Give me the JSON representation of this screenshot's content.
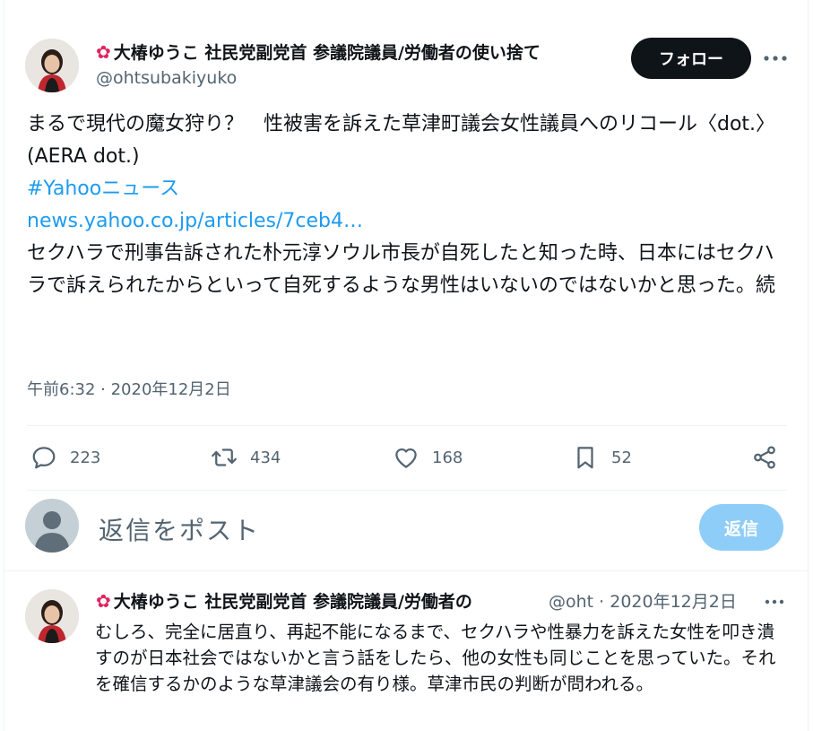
{
  "main_tweet": {
    "display_name": "大椿ゆうこ 社民党副党首 参議院議員/労働者の使い捨て",
    "handle": "@ohtsubakiyuko",
    "follow_label": "フォロー",
    "text_line1": "まるで現代の魔女狩り？　性被害を訴えた草津町議会女性議員へのリコール〈dot.〉(AERA dot.)",
    "hashtag": "#Yahooニュース",
    "link": "news.yahoo.co.jp/articles/7ceb4…",
    "text_line2": "セクハラで刑事告訴された朴元淳ソウル市長が自死したと知った時、日本にはセクハラで訴えられたからといって自死するような男性はいないのではないかと思った。続",
    "timestamp": "午前6:32 · 2020年12月2日",
    "stats": {
      "replies": "223",
      "retweets": "434",
      "likes": "168",
      "bookmarks": "52"
    }
  },
  "reply_box": {
    "placeholder": "返信をポスト",
    "button_label": "返信"
  },
  "thread_reply": {
    "display_name": "大椿ゆうこ 社民党副党首 参議院議員/労働者の",
    "meta": "@oht · 2020年12月2日",
    "text": "むしろ、完全に居直り、再起不能になるまで、セクハラや性暴力を訴えた女性を叩き潰すのが日本社会ではないかと言う話をしたら、他の女性も同じことを思っていた。それを確信するかのような草津議会の有り様。草津市民の判断が問われる。"
  },
  "icons": {
    "flower": "hibiscus-icon",
    "reply": "reply-icon",
    "retweet": "retweet-icon",
    "like": "heart-icon",
    "bookmark": "bookmark-icon",
    "share": "share-icon",
    "more": "more-icon"
  },
  "colors": {
    "text": "#0f1419",
    "secondary": "#536471",
    "link": "#1d9bf0",
    "follow_bg": "#0f1419",
    "reply_btn_bg": "#8ecdf7",
    "flower": "#e0245e"
  }
}
